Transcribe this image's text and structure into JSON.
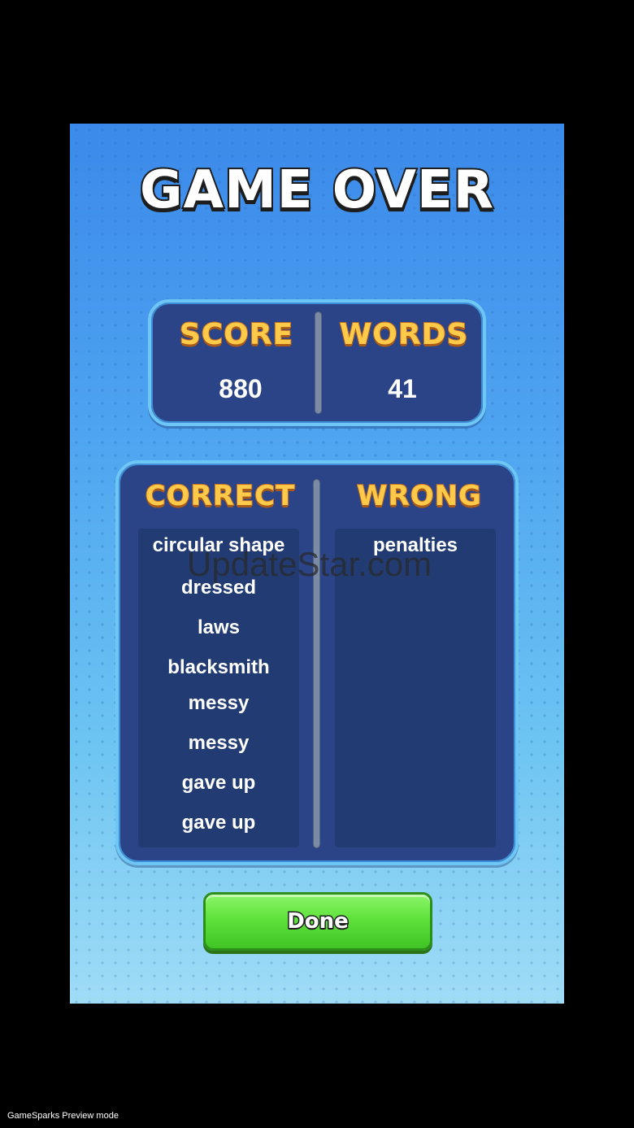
{
  "screen": {
    "title": "GAME OVER",
    "colors": {
      "background_top": "#3b89ea",
      "background_bottom": "#9fdcf6",
      "panel": "#2b4488",
      "panel_border": "#6ec6f4",
      "heading": "#ffc94a",
      "button": "#5fe23c"
    }
  },
  "stats": {
    "score_label": "SCORE",
    "score_value": "880",
    "words_label": "WORDS",
    "words_value": "41"
  },
  "lists": {
    "correct_label": "CORRECT",
    "wrong_label": "WRONG",
    "correct_items": [
      "circular shape",
      "dressed",
      "laws",
      "blacksmith",
      "messy",
      "messy",
      "gave up",
      "gave up"
    ],
    "wrong_items": [
      "penalties"
    ]
  },
  "done_button": {
    "label": "Done"
  },
  "watermark": "UpdateStar.com",
  "footer": {
    "text": "GameSparks Preview mode"
  }
}
